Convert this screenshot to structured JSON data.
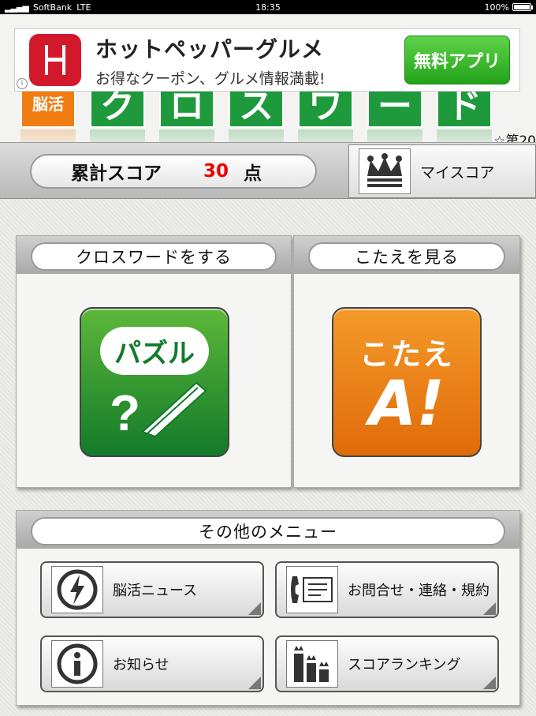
{
  "status_bar": {
    "carrier": "SoftBank",
    "network": "LTE",
    "time": "18:35",
    "battery": "100%"
  },
  "ad": {
    "title": "ホットペッパーグルメ",
    "subtitle": "お得なクーポン、グルメ情報満載!",
    "button_label": "無料アプリ",
    "info_icon": "info-icon"
  },
  "title": {
    "badge": "脳活",
    "letters": [
      "ク",
      "ロ",
      "ス",
      "ワ",
      "ー",
      "ド"
    ],
    "edition": "☆第20"
  },
  "score": {
    "label": "累計スコア",
    "value": "30",
    "unit": "点",
    "my_score_label": "マイスコア"
  },
  "crossword_panel": {
    "label": "クロスワードをする",
    "button_text": "パズル",
    "icon": "pen-question-icon"
  },
  "answer_panel": {
    "label": "こたえを見る",
    "button_text": "こたえ",
    "button_glyph": "A!",
    "icon": "answer-icon"
  },
  "other_menu": {
    "label": "その他のメニュー",
    "items": [
      {
        "label": "脳活ニュース",
        "icon": "news-icon"
      },
      {
        "label": "お問合せ・連絡・規約",
        "icon": "contact-icon"
      },
      {
        "label": "お知らせ",
        "icon": "info-icon"
      },
      {
        "label": "スコアランキング",
        "icon": "ranking-icon"
      }
    ]
  },
  "colors": {
    "accent_green": "#1e9a3d",
    "accent_orange": "#f07c12",
    "score_red": "#e00000",
    "ad_red": "#d2192b"
  }
}
